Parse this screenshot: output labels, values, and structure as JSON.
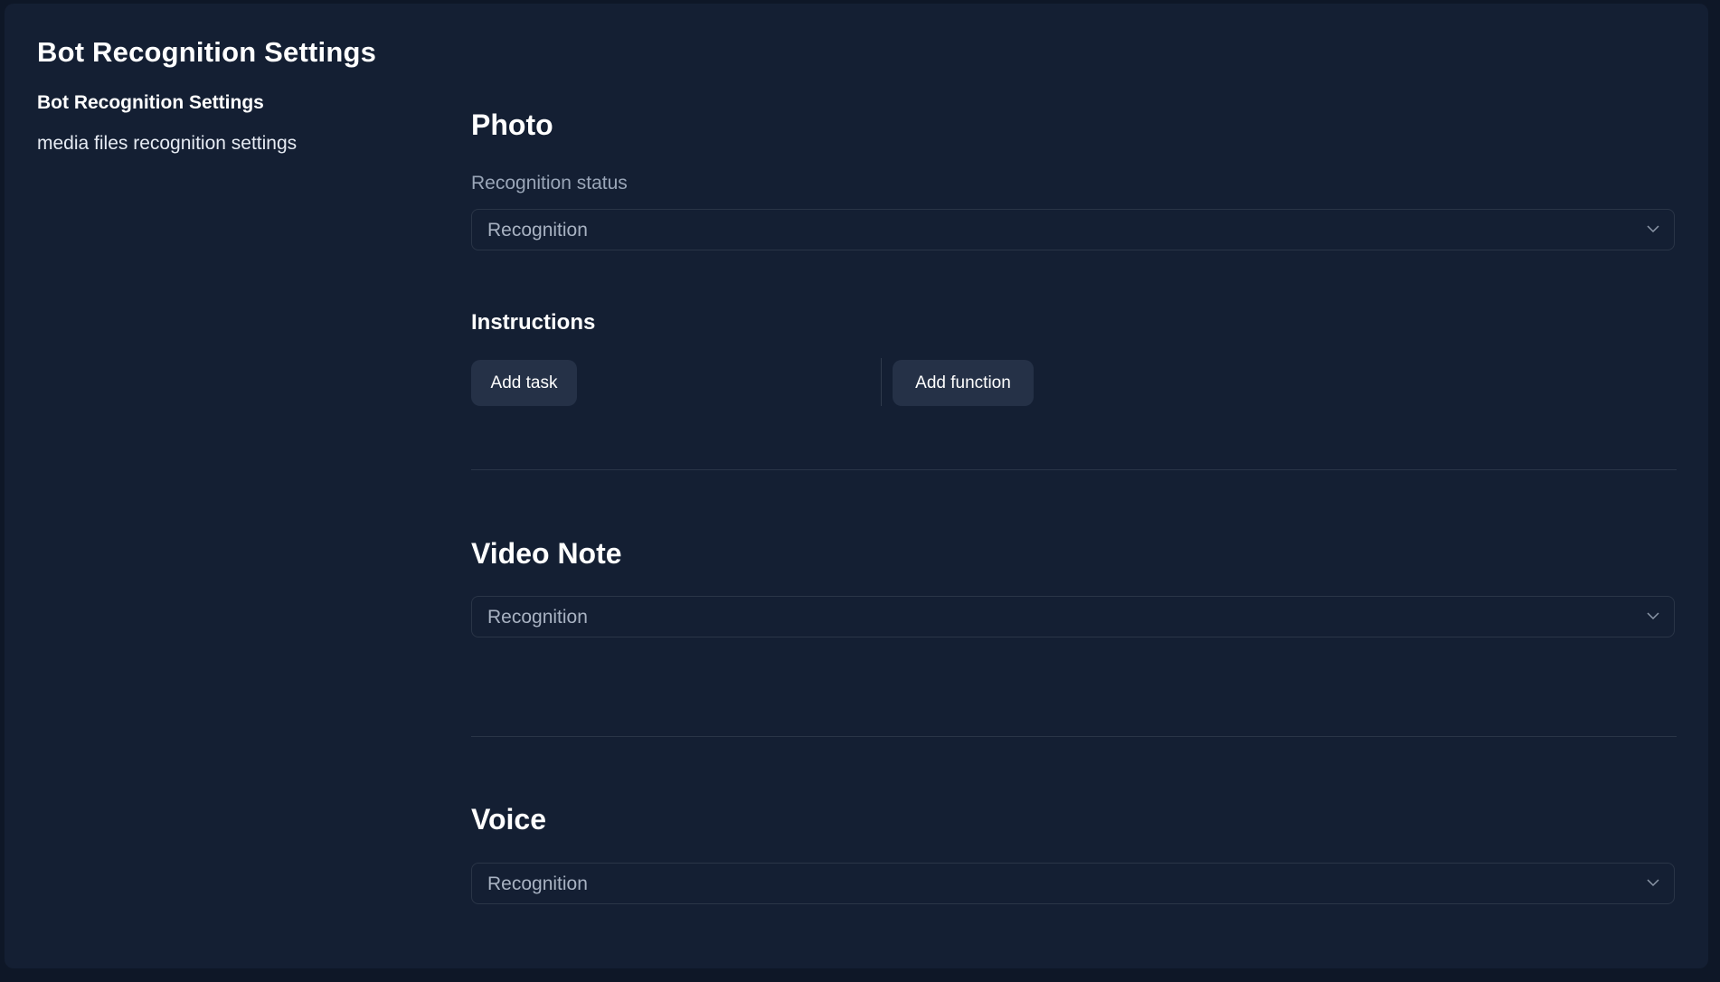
{
  "header": {
    "title": "Bot Recognition Settings"
  },
  "nav": {
    "items": [
      {
        "label": "Bot Recognition Settings",
        "active": true
      },
      {
        "label": "media files recognition settings",
        "active": false
      }
    ]
  },
  "photo": {
    "title": "Photo",
    "status_label": "Recognition status",
    "status_value": "Recognition",
    "instructions": {
      "title": "Instructions",
      "add_task_label": "Add task",
      "add_function_label": "Add function"
    }
  },
  "video_note": {
    "title": "Video Note",
    "status_value": "Recognition"
  },
  "voice": {
    "title": "Voice",
    "status_value": "Recognition"
  },
  "icons": {
    "select_chevron": "chevron-down-icon"
  },
  "colors": {
    "background": "#0e1727",
    "panel": "#141f33",
    "button": "#253147",
    "border": "#2a3547",
    "muted_text": "#9aa6b8"
  }
}
